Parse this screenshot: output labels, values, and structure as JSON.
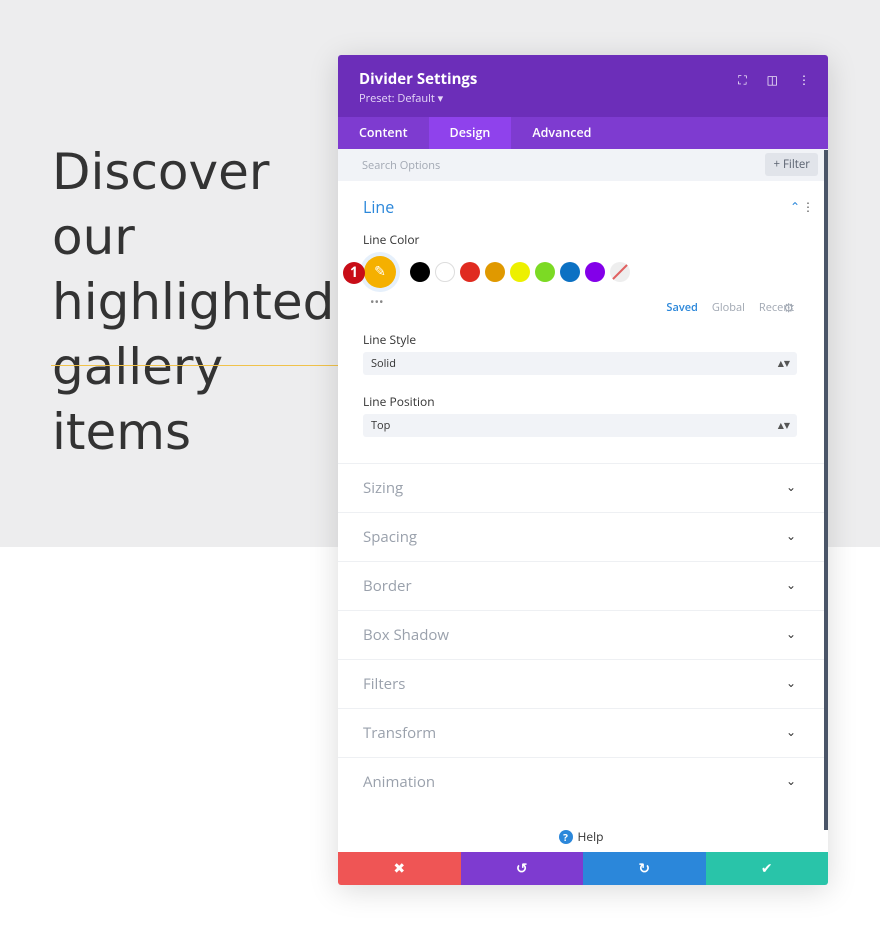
{
  "page": {
    "heading": "Discover our\nhighlighted\ngallery items"
  },
  "panel": {
    "title": "Divider Settings",
    "preset": "Preset: Default ▾",
    "tabs": [
      {
        "label": "Content"
      },
      {
        "label": "Design"
      },
      {
        "label": "Advanced"
      }
    ],
    "search_placeholder": "Search Options",
    "filter_label": "+ Filter",
    "line": {
      "title": "Line",
      "color_label": "Line Color",
      "badge": "1",
      "swatches": [
        "#000000",
        "#ffffff",
        "#e02b20",
        "#e09900",
        "#edf000",
        "#7cda24",
        "#0c71c3",
        "#8300e9"
      ],
      "palette_tabs": [
        "Saved",
        "Global",
        "Recent"
      ],
      "style_label": "Line Style",
      "style_value": "Solid",
      "position_label": "Line Position",
      "position_value": "Top"
    },
    "groups": [
      "Sizing",
      "Spacing",
      "Border",
      "Box Shadow",
      "Filters",
      "Transform",
      "Animation"
    ],
    "help": "Help"
  },
  "colors": {
    "header": "#6c2eb9",
    "accent": "#2b87da",
    "cancel": "#ef5555",
    "undo": "#7e3bd0",
    "redo": "#2b87da",
    "save": "#29c4a9"
  }
}
